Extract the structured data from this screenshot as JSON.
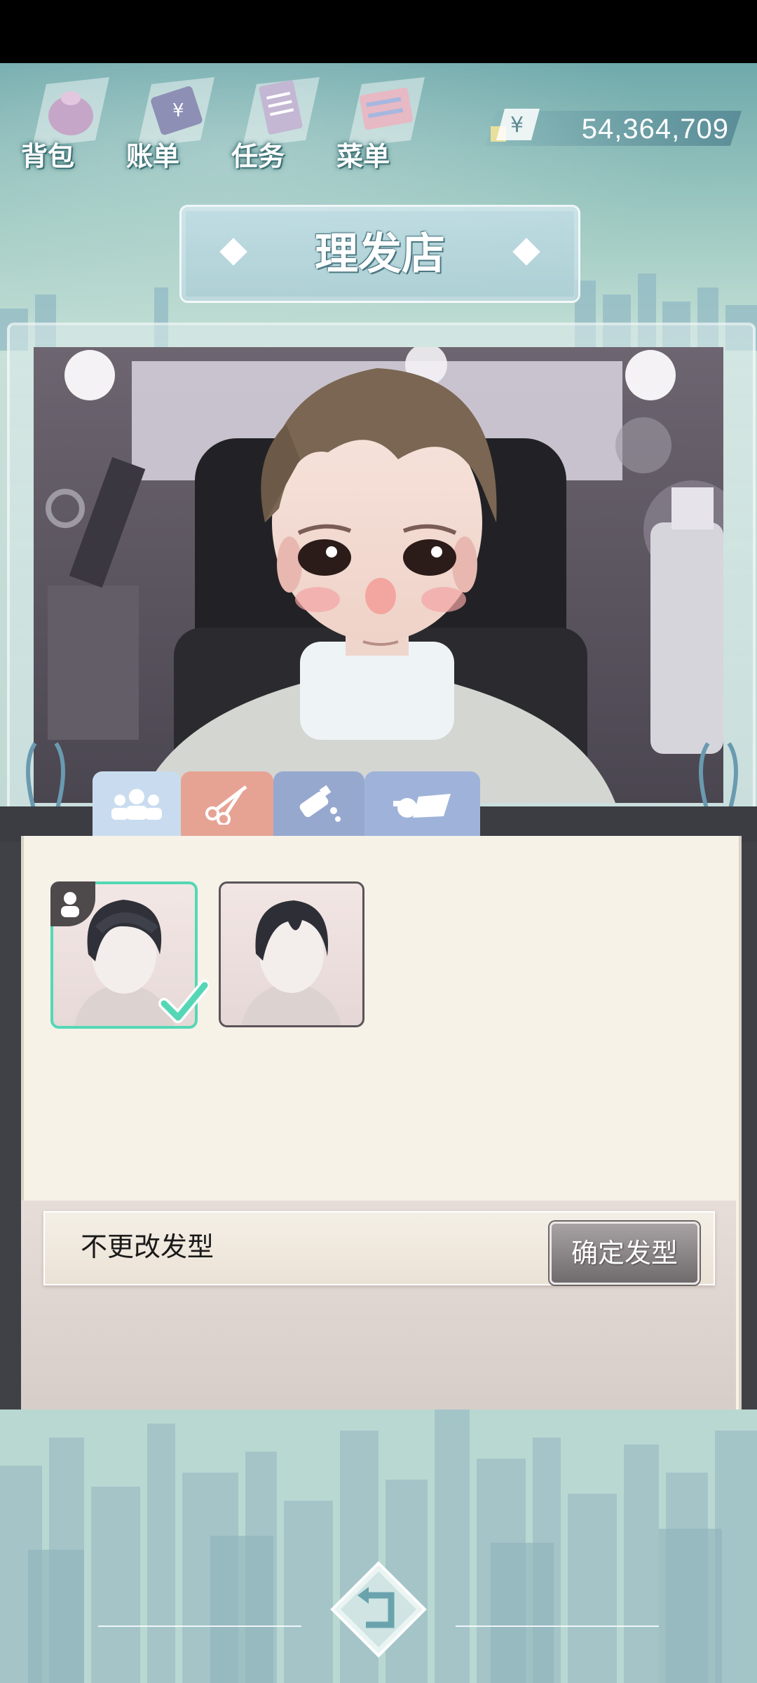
{
  "nav": {
    "items": [
      {
        "label": "背包",
        "icon": "bag-icon"
      },
      {
        "label": "账单",
        "icon": "bill-icon"
      },
      {
        "label": "任务",
        "icon": "task-icon"
      },
      {
        "label": "菜单",
        "icon": "menu-icon"
      }
    ]
  },
  "wallet": {
    "currency_symbol": "¥",
    "amount": "54,364,709"
  },
  "header": {
    "title": "理发店"
  },
  "tabs": [
    {
      "name": "avatar",
      "icon": "people-icon",
      "selected": false
    },
    {
      "name": "haircut",
      "icon": "scissors-icon",
      "selected": true
    },
    {
      "name": "hair-dye",
      "icon": "dye-bottle-icon",
      "selected": false
    },
    {
      "name": "accessory",
      "icon": "accessory-icon",
      "selected": false
    }
  ],
  "hairstyles": [
    {
      "id": "current",
      "selected": true,
      "badge": "person-icon"
    },
    {
      "id": "option-2",
      "selected": false
    }
  ],
  "footer": {
    "no_change_label": "不更改发型",
    "confirm_label": "确定发型"
  },
  "colors": {
    "accent_selected": "#55d7b6",
    "tab_scissors": "#e6a394",
    "tab_avatar": "#c9dcef",
    "paper": "#f6f2e8"
  }
}
